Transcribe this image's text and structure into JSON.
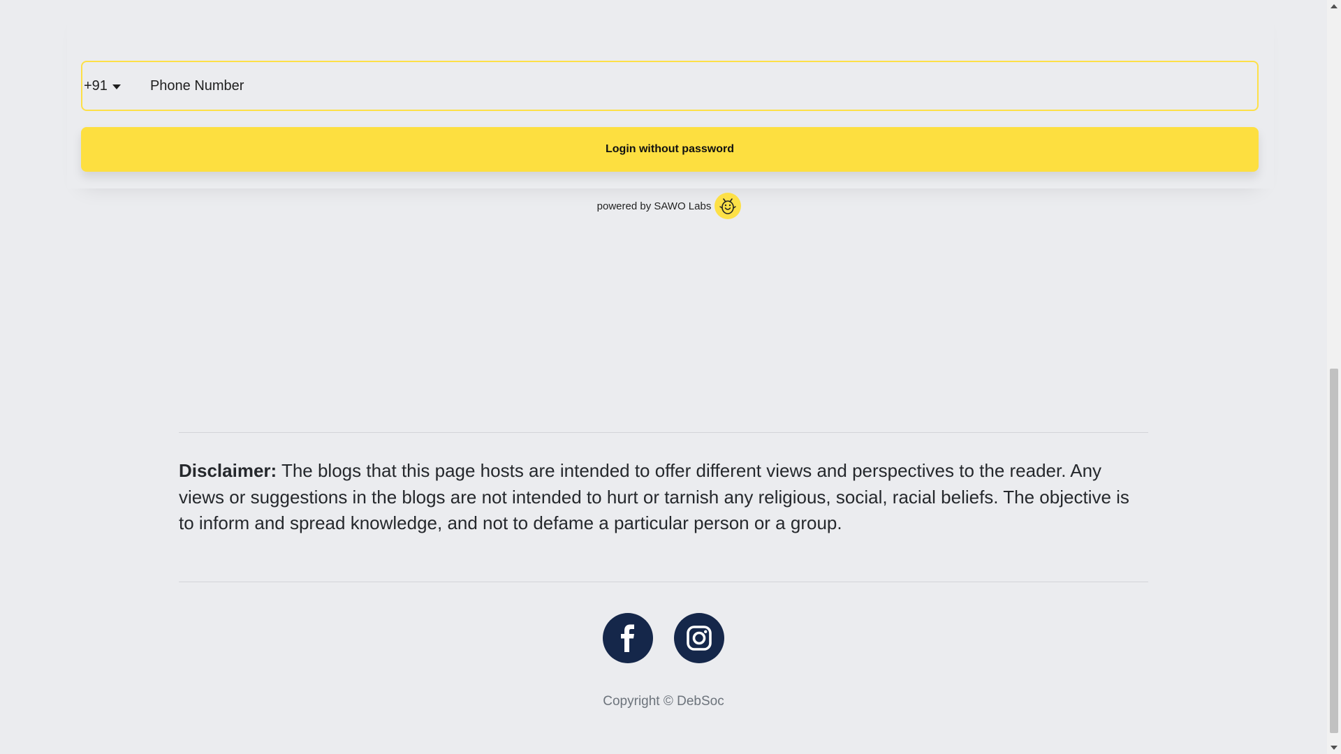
{
  "login": {
    "country_code": "+91",
    "phone_placeholder": "Phone Number",
    "button_label": "Login without password",
    "powered_by": "powered by SAWO Labs"
  },
  "footer": {
    "disclaimer_label": "Disclaimer:",
    "disclaimer_text": " The blogs that this page hosts are intended to offer different views and perspectives to the reader. Any views or suggestions in the blogs are not intended to hurt or tarnish any religious, social, racial beliefs. The objective is to inform and spread knowledge, and not to defame a particular person or a group.",
    "social": [
      {
        "name": "facebook",
        "icon": "facebook-icon"
      },
      {
        "name": "instagram",
        "icon": "instagram-icon"
      }
    ],
    "copyright": "Copyright © DebSoc"
  },
  "colors": {
    "background": "#ebecef",
    "accent_yellow": "#fddf40",
    "social_bg": "#15274a"
  }
}
